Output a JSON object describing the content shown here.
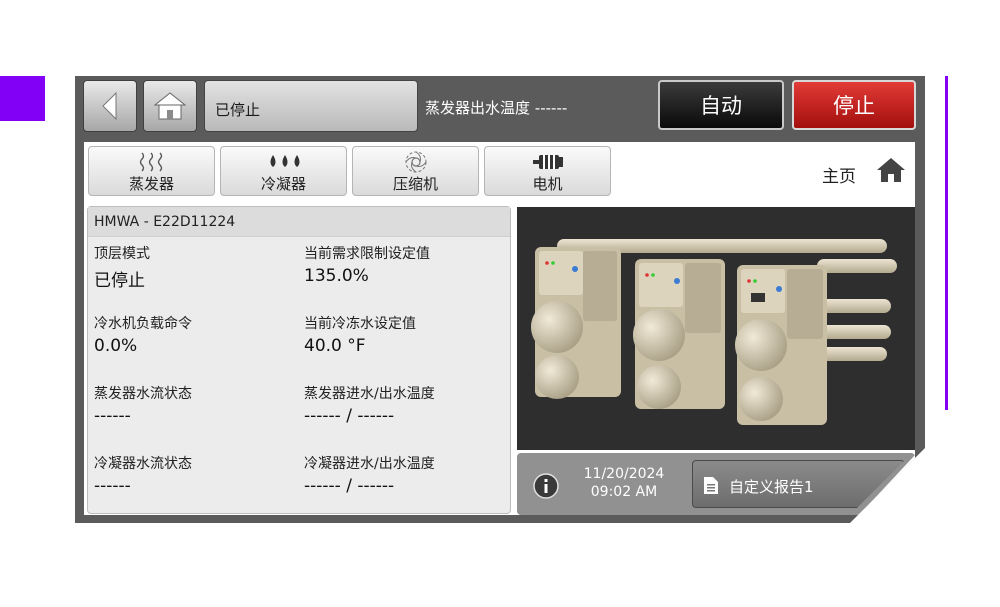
{
  "header": {
    "status": "已停止",
    "evap_leaving_label": "蒸发器出水温度",
    "evap_leaving_value": "------",
    "auto_label": "自动",
    "stop_label": "停止"
  },
  "tabs": [
    {
      "label": "蒸发器",
      "icon": "evaporator-icon"
    },
    {
      "label": "冷凝器",
      "icon": "condenser-icon"
    },
    {
      "label": "压缩机",
      "icon": "compressor-icon"
    },
    {
      "label": "电机",
      "icon": "motor-icon"
    }
  ],
  "home_link": {
    "label": "主页",
    "icon": "home-icon"
  },
  "unit": {
    "title": "HMWA - E22D11224"
  },
  "fields": [
    {
      "label": "顶层模式",
      "value": "已停止"
    },
    {
      "label": "当前需求限制设定值",
      "value": "135.0%"
    },
    {
      "label": "冷水机负载命令",
      "value": "0.0%"
    },
    {
      "label": "当前冷冻水设定值",
      "value": "40.0 °F"
    },
    {
      "label": "蒸发器水流状态",
      "value": "------"
    },
    {
      "label": "蒸发器进水/出水温度",
      "value": "------ / ------"
    },
    {
      "label": "冷凝器水流状态",
      "value": "------"
    },
    {
      "label": "冷凝器进水/出水温度",
      "value": "------ / ------"
    }
  ],
  "footer": {
    "date": "11/20/2024",
    "time": "09:02 AM",
    "report_label": "自定义报告1"
  },
  "colors": {
    "accent": "#8200f5",
    "stop": "#c0201e",
    "panel": "#5b5b5b"
  }
}
